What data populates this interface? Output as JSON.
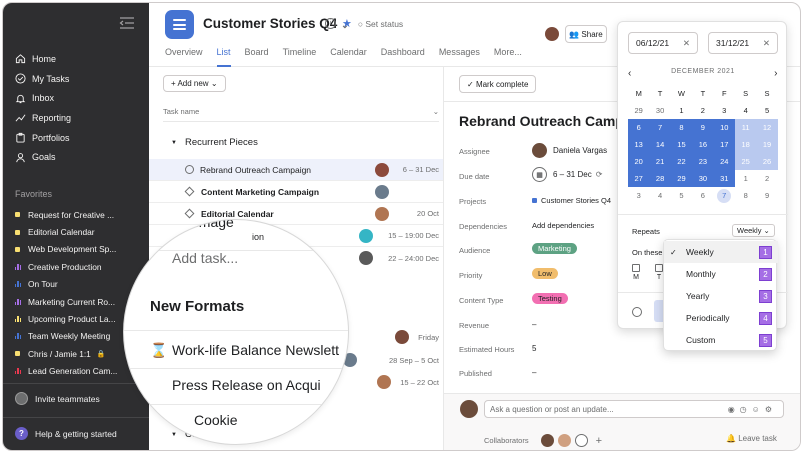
{
  "sidebar": {
    "nav": [
      {
        "label": "Home",
        "icon": "home-icon"
      },
      {
        "label": "My Tasks",
        "icon": "check-circle-icon"
      },
      {
        "label": "Inbox",
        "icon": "bell-icon"
      },
      {
        "label": "Reporting",
        "icon": "chart-line-icon"
      },
      {
        "label": "Portfolios",
        "icon": "clipboard-icon"
      },
      {
        "label": "Goals",
        "icon": "person-icon"
      }
    ],
    "favorites_title": "Favorites",
    "favorites": [
      {
        "label": "Request for Creative ...",
        "kind": "dot",
        "color": "#f8df72"
      },
      {
        "label": "Editorial Calendar",
        "kind": "dot",
        "color": "#f8df72"
      },
      {
        "label": "Web Development Sp...",
        "kind": "dot",
        "color": "#f8df72"
      },
      {
        "label": "Creative Production",
        "kind": "bars",
        "color": "#a56ee5"
      },
      {
        "label": "On Tour",
        "kind": "bars",
        "color": "#4573d2"
      },
      {
        "label": "Marketing Current Ro...",
        "kind": "bars",
        "color": "#a56ee5"
      },
      {
        "label": "Upcoming Product La...",
        "kind": "bars",
        "color": "#f8df72"
      },
      {
        "label": "Team Weekly Meeting",
        "kind": "bars",
        "color": "#4573d2"
      },
      {
        "label": "Chris / Jamie 1:1",
        "kind": "dot",
        "color": "#f8df72",
        "locked": true
      },
      {
        "label": "Lead Generation Cam...",
        "kind": "bars",
        "color": "#e8384f"
      }
    ],
    "invite": "Invite teammates",
    "help": "Help & getting started"
  },
  "header": {
    "title": "Customer Stories Q4",
    "set_status": "Set status",
    "share": "Share",
    "tabs": [
      "Overview",
      "List",
      "Board",
      "Timeline",
      "Calendar",
      "Dashboard",
      "Messages",
      "More..."
    ],
    "active_tab": "List"
  },
  "list": {
    "add_new": "+ Add new",
    "column_header": "Task name",
    "sections": {
      "recurrent": "Recurrent Pieces",
      "content": "Content"
    },
    "rows": [
      {
        "name": "Rebrand Outreach Campaign",
        "date": "6 – 31 Dec",
        "marker": "check",
        "bold": false
      },
      {
        "name": "Content Marketing Campaign",
        "date": "",
        "marker": "diamond",
        "bold": true
      },
      {
        "name": "Editorial Calendar",
        "date": "20 Oct",
        "marker": "diamond",
        "bold": true
      },
      {
        "name": "",
        "date": "15 – 19:00 Dec",
        "marker": "check",
        "bold": false
      },
      {
        "name": "",
        "date": "22 – 24:00 Dec",
        "marker": "",
        "bold": false
      }
    ],
    "magnifier": {
      "partial_top": "y Image",
      "partial_top2": "ion",
      "add_task": "Add task...",
      "new_section": "New Formats",
      "item1": "Work-life Balance Newslett",
      "item2": "Press Release on Acqui",
      "partial_bottom": "Cookie"
    },
    "extra_dates": [
      "Friday",
      "28 Sep – 5 Oct",
      "15 – 22 Oct"
    ]
  },
  "detail": {
    "mark_complete": "Mark complete",
    "title": "Rebrand Outreach Camp",
    "fields": [
      {
        "label": "Assignee",
        "value": "Daniela Vargas"
      },
      {
        "label": "Due date",
        "value": "6 – 31 Dec"
      },
      {
        "label": "Projects",
        "value": "Customer Stories Q4"
      },
      {
        "label": "Dependencies",
        "value": "Add dependencies"
      },
      {
        "label": "Audience",
        "value": "Marketing"
      },
      {
        "label": "Priority",
        "value": "Low"
      },
      {
        "label": "Content Type",
        "value": "Testing"
      },
      {
        "label": "Revenue",
        "value": "–"
      },
      {
        "label": "Estimated Hours",
        "value": "5"
      },
      {
        "label": "Published",
        "value": "–"
      }
    ],
    "comment_placeholder": "Ask a question or post an update...",
    "collaborators": "Collaborators",
    "leave_task": "Leave task"
  },
  "datepicker": {
    "start": "06/12/21",
    "end": "31/12/21",
    "month": "DECEMBER 2021",
    "dow": [
      "M",
      "T",
      "W",
      "T",
      "F",
      "S",
      "S"
    ],
    "weeks": [
      [
        "29",
        "30",
        "1",
        "2",
        "3",
        "4",
        "5"
      ],
      [
        "6",
        "7",
        "8",
        "9",
        "10",
        "11",
        "12"
      ],
      [
        "13",
        "14",
        "15",
        "16",
        "17",
        "18",
        "19"
      ],
      [
        "20",
        "21",
        "22",
        "23",
        "24",
        "25",
        "26"
      ],
      [
        "27",
        "28",
        "29",
        "30",
        "31",
        "1",
        "2"
      ],
      [
        "3",
        "4",
        "5",
        "6",
        "7",
        "8",
        "9"
      ]
    ],
    "repeats_label": "Repeats",
    "repeats_value": "Weekly",
    "on_these": "On these",
    "wk_letters": [
      "M",
      "T"
    ]
  },
  "repeat_options": [
    {
      "label": "Weekly",
      "num": "1",
      "checked": true
    },
    {
      "label": "Monthly",
      "num": "2"
    },
    {
      "label": "Yearly",
      "num": "3"
    },
    {
      "label": "Periodically",
      "num": "4"
    },
    {
      "label": "Custom",
      "num": "5"
    }
  ],
  "colors": {
    "accent": "#4573d2",
    "sidebar": "#2e2e30",
    "marketing_pill": "#5da283",
    "low_pill": "#f1bd6c",
    "testing_pill": "#f26fb2",
    "number_badge": "#a56ee5"
  }
}
